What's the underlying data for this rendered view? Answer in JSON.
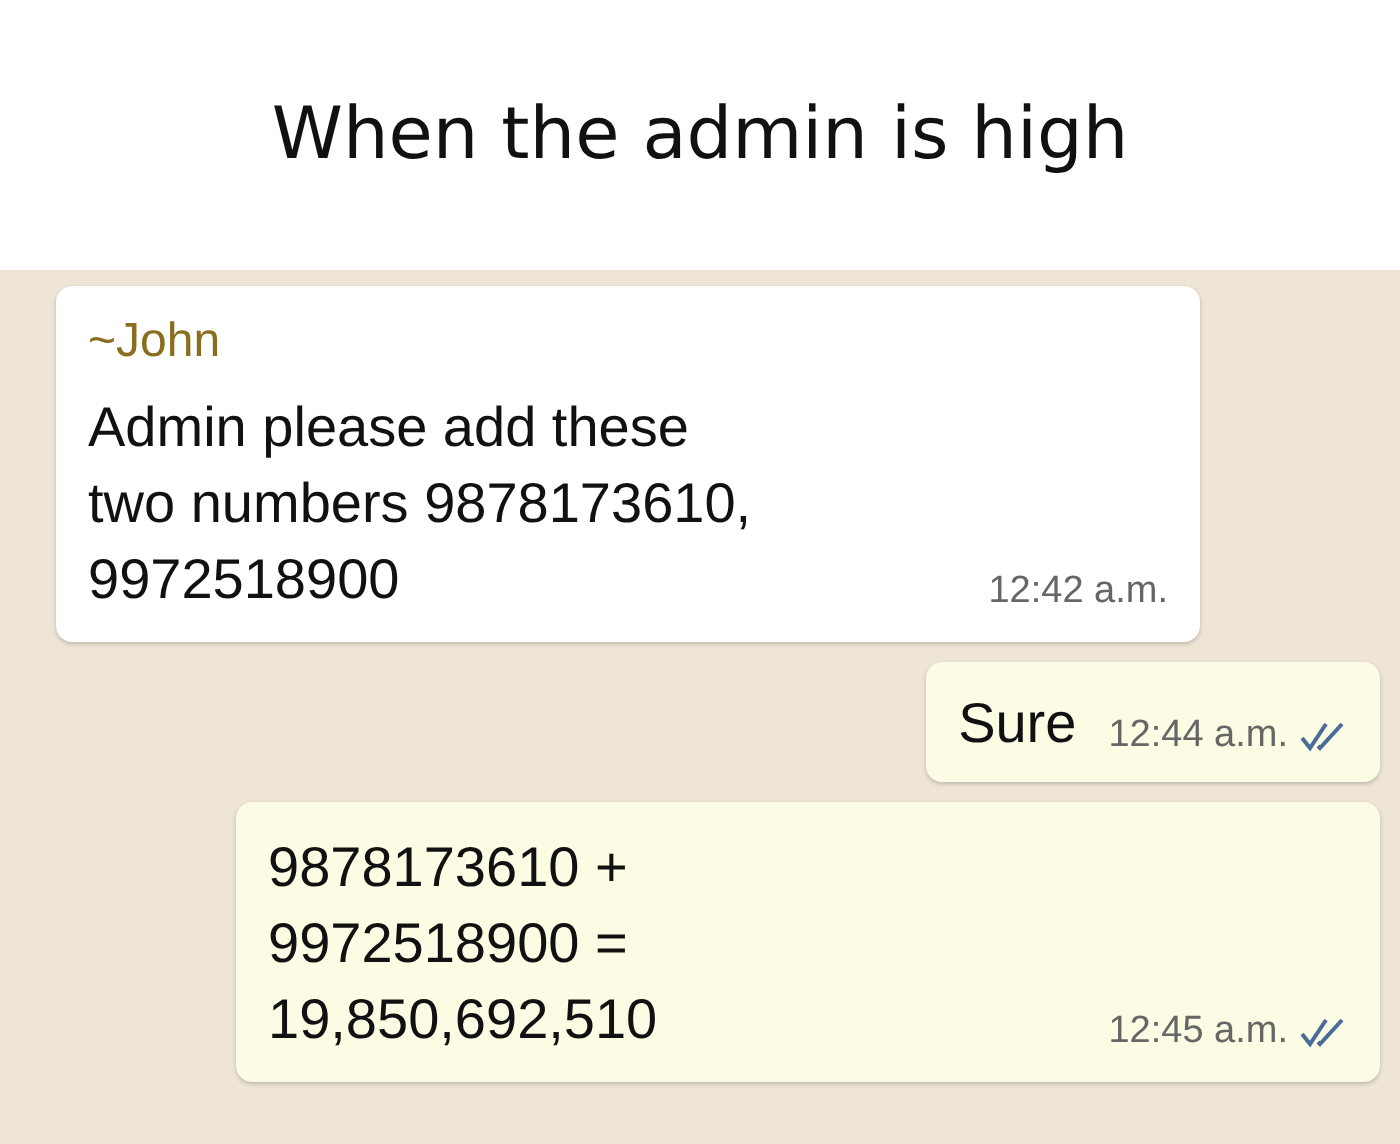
{
  "caption": "When the admin is high",
  "messages": [
    {
      "kind": "incoming",
      "sender": "~John",
      "lines": [
        "Admin please add these",
        "two numbers 9878173610,",
        "9972518900"
      ],
      "time": "12:42 a.m."
    },
    {
      "kind": "outgoing",
      "lines": [
        "Sure"
      ],
      "time": "12:44 a.m."
    },
    {
      "kind": "outgoing",
      "lines": [
        "9878173610 +",
        "9972518900 =",
        "19,850,692,510"
      ],
      "time": "12:45 a.m."
    }
  ]
}
